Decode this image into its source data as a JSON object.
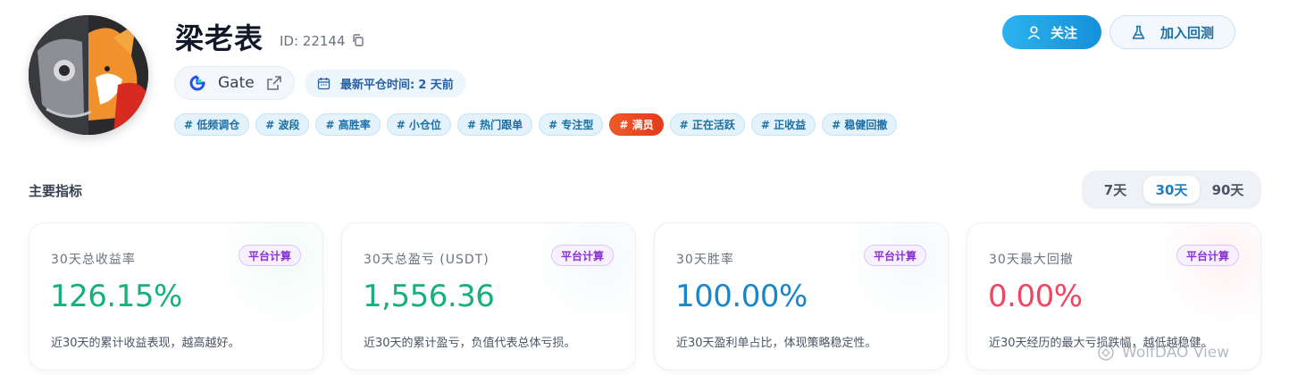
{
  "profile": {
    "name": "梁老表",
    "uid": "ID: 22144",
    "exchange": "Gate",
    "last_close_label": "最新平仓时间:",
    "last_close_value": "2 天前",
    "tags": [
      {
        "label": "# 低频调仓",
        "hot": false
      },
      {
        "label": "# 波段",
        "hot": false
      },
      {
        "label": "# 高胜率",
        "hot": false
      },
      {
        "label": "# 小仓位",
        "hot": false
      },
      {
        "label": "# 热门跟单",
        "hot": false
      },
      {
        "label": "# 专注型",
        "hot": false
      },
      {
        "label": "# 满员",
        "hot": true
      },
      {
        "label": "# 正在活跃",
        "hot": false
      },
      {
        "label": "# 正收益",
        "hot": false
      },
      {
        "label": "# 稳健回撤",
        "hot": false
      }
    ]
  },
  "actions": {
    "follow_label": "关注",
    "backtest_label": "加入回测"
  },
  "metrics_section": {
    "title": "主要指标",
    "periods": [
      "7天",
      "30天",
      "90天"
    ],
    "active_period": "30天"
  },
  "cards": [
    {
      "title": "30天总收益率",
      "badge": "平台计算",
      "value": "126.15%",
      "desc": "近30天的累计收益表现，越高越好。",
      "value_color": "#18b07a",
      "glow": "rgba(120,220,180,0.10)"
    },
    {
      "title": "30天总盈亏 (USDT)",
      "badge": "平台计算",
      "value": "1,556.36",
      "desc": "近30天的累计盈亏，负值代表总体亏损。",
      "value_color": "#18b07a",
      "glow": "rgba(150,200,240,0.10)"
    },
    {
      "title": "30天胜率",
      "badge": "平台计算",
      "value": "100.00%",
      "desc": "近30天盈利单占比，体现策略稳定性。",
      "value_color": "#1a86c7",
      "glow": "rgba(150,200,240,0.10)"
    },
    {
      "title": "30天最大回撤",
      "badge": "平台计算",
      "value": "0.00%",
      "desc": "近30天经历的最大亏损跌幅，越低越稳健。",
      "value_color": "#ef4664",
      "glow": "rgba(245,160,170,0.13)"
    }
  ],
  "watermark": "WolfDAO View",
  "colors": {
    "accent": "#1a86c7",
    "positive": "#18b07a",
    "negative": "#ef4664",
    "hot_tag": "#e33b1c",
    "badge": "#8a33d1"
  },
  "icons": [
    "copy-icon",
    "gate-logo-icon",
    "external-link-icon",
    "calendar-icon",
    "user-icon",
    "flask-icon",
    "watermark-icon"
  ]
}
